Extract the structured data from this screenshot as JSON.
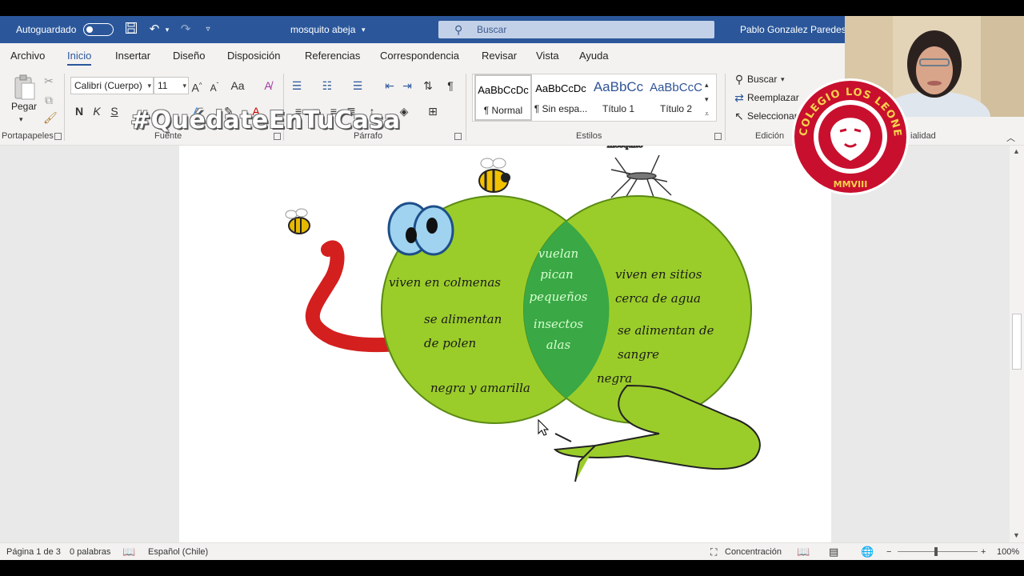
{
  "titlebar": {
    "autosave_label": "Autoguardado",
    "doc_title": "mosquito abeja",
    "search_placeholder": "Buscar",
    "user_name": "Pablo Gonzalez Paredes"
  },
  "tabs": [
    "Archivo",
    "Inicio",
    "Insertar",
    "Diseño",
    "Disposición",
    "Referencias",
    "Correspondencia",
    "Revisar",
    "Vista",
    "Ayuda"
  ],
  "ribbon": {
    "clipboard": {
      "paste_label": "Pegar",
      "group_label": "Portapapeles"
    },
    "font": {
      "font_name": "Calibri (Cuerpo)",
      "font_size": "11",
      "change_case": "Aa",
      "bold": "N",
      "italic": "K",
      "underline": "S",
      "group_label": "Fuente"
    },
    "paragraph": {
      "group_label": "Párrafo"
    },
    "styles": {
      "items": [
        {
          "preview": "AaBbCcDc",
          "name": "¶ Normal"
        },
        {
          "preview": "AaBbCcDc",
          "name": "¶ Sin espa..."
        },
        {
          "preview": "AaBbCc",
          "name": "Título 1"
        },
        {
          "preview": "AaBbCcC",
          "name": "Título 2"
        }
      ],
      "group_label": "Estilos"
    },
    "editing": {
      "find": "Buscar",
      "replace": "Reemplazar",
      "select": "Seleccionar",
      "group_label": "Edición",
      "extra_label": "ialidad"
    }
  },
  "overlay": {
    "hashtag": "#QuédateEnTuCasa"
  },
  "logo": {
    "ring_text": "COLEGIO LOS LEONES DE QUILPUE",
    "year": "MMVIII"
  },
  "document": {
    "left_text": [
      "viven en colmenas",
      "se alimentan",
      "de polen",
      "negra y amarilla"
    ],
    "center_text": [
      "vuelan",
      "pican",
      "pequeños",
      "insectos",
      "alas"
    ],
    "right_text": [
      "viven en sitios",
      "cerca de agua",
      "se alimentan de",
      "sangre",
      "negra"
    ]
  },
  "status": {
    "page": "Página 1 de 3",
    "words": "0 palabras",
    "language": "Español (Chile)",
    "focus": "Concentración",
    "zoom": "100%"
  }
}
